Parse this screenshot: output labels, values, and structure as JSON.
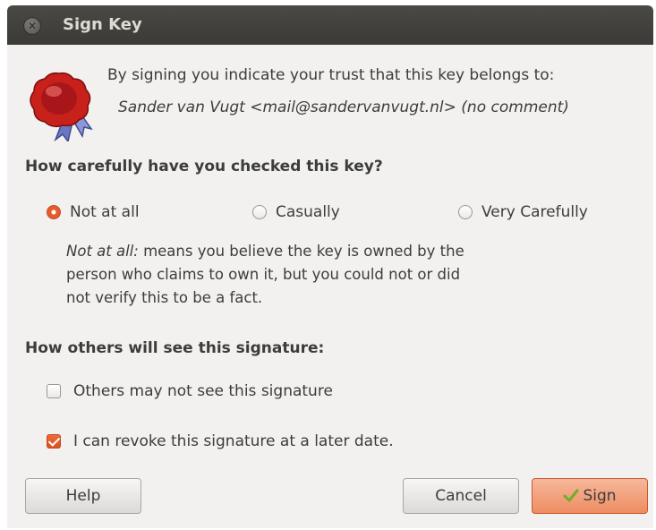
{
  "window": {
    "title": "Sign Key"
  },
  "intro": {
    "text": "By signing you indicate your trust that this key belongs to:",
    "identity": "Sander van Vugt <mail@sandervanvugt.nl> (no comment)"
  },
  "check_section": {
    "heading": "How carefully have you checked this key?",
    "options": [
      "Not at all",
      "Casually",
      "Very Carefully"
    ],
    "selected": "Not at all",
    "description_term": "Not at all:",
    "description_line1": " means you believe the key is owned by the",
    "description_line2": "person who claims to own it, but you could not or did",
    "description_line3": "not verify this to be a fact."
  },
  "visibility_section": {
    "heading": "How others will see this signature:",
    "others_may_not_see": {
      "label": "Others may not see this signature",
      "checked": false
    },
    "can_revoke": {
      "label": "I can revoke this signature at a later date.",
      "checked": true
    }
  },
  "buttons": {
    "help": "Help",
    "cancel": "Cancel",
    "sign": "Sign"
  },
  "colors": {
    "accent": "#e55c2c",
    "titlebar": "#3c3b37",
    "dialog_bg": "#f2f1f0"
  }
}
